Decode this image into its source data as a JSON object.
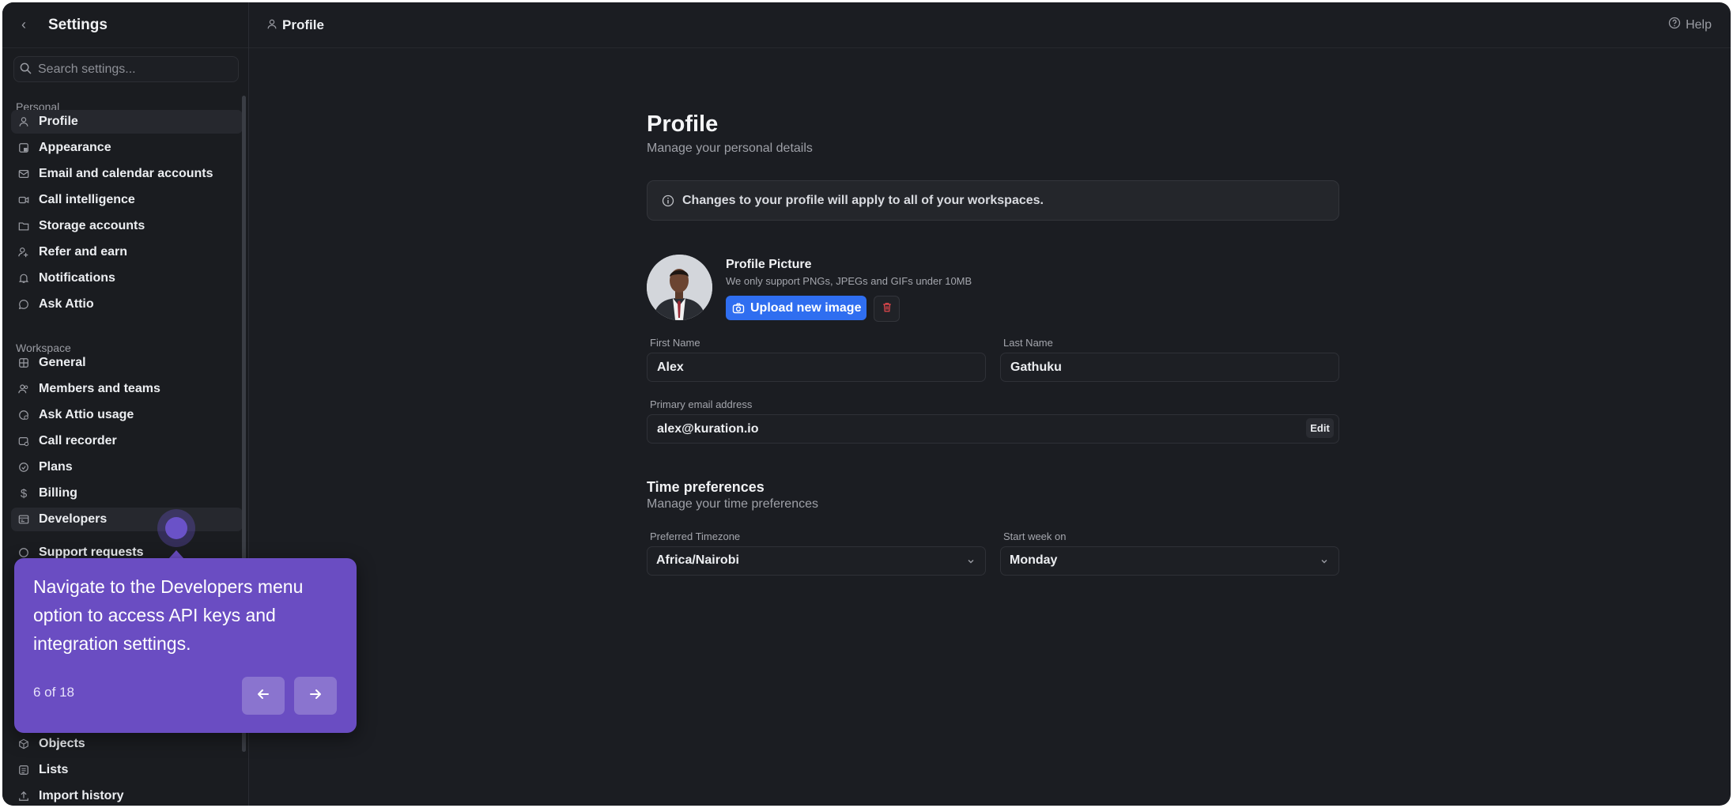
{
  "sidebar": {
    "title": "Settings",
    "search_placeholder": "Search settings...",
    "personal_label": "Personal",
    "workspace_label": "Workspace",
    "items": [
      {
        "label": "Profile",
        "icon": "user-icon"
      },
      {
        "label": "Appearance",
        "icon": "appearance-icon"
      },
      {
        "label": "Email and calendar accounts",
        "icon": "mail-calendar-icon"
      },
      {
        "label": "Call intelligence",
        "icon": "video-icon"
      },
      {
        "label": "Storage accounts",
        "icon": "folder-icon"
      },
      {
        "label": "Refer and earn",
        "icon": "refer-icon"
      },
      {
        "label": "Notifications",
        "icon": "bell-icon"
      },
      {
        "label": "Ask Attio",
        "icon": "chat-icon"
      },
      {
        "label": "General",
        "icon": "grid-icon"
      },
      {
        "label": "Members and teams",
        "icon": "users-icon"
      },
      {
        "label": "Ask Attio usage",
        "icon": "usage-icon"
      },
      {
        "label": "Call recorder",
        "icon": "recorder-icon"
      },
      {
        "label": "Plans",
        "icon": "plans-icon"
      },
      {
        "label": "Billing",
        "icon": "dollar-icon"
      },
      {
        "label": "Developers",
        "icon": "developers-icon"
      },
      {
        "label": "Support requests",
        "icon": "support-icon"
      },
      {
        "label": "Objects",
        "icon": "cube-icon"
      },
      {
        "label": "Lists",
        "icon": "list-icon"
      },
      {
        "label": "Import history",
        "icon": "upload-icon"
      }
    ]
  },
  "topbar": {
    "title": "Profile",
    "help_label": "Help"
  },
  "main": {
    "title": "Profile",
    "subtitle": "Manage your personal details",
    "notice": "Changes to your profile will apply to all of your workspaces.",
    "picture_title": "Profile Picture",
    "picture_hint": "We only support PNGs, JPEGs and GIFs under 10MB",
    "upload_label": "Upload new image",
    "first_name_label": "First Name",
    "first_name": "Alex",
    "last_name_label": "Last Name",
    "last_name": "Gathuku",
    "email_label": "Primary email address",
    "email": "alex@kuration.io",
    "edit_label": "Edit",
    "time_title": "Time preferences",
    "time_subtitle": "Manage your time preferences",
    "timezone_label": "Preferred Timezone",
    "timezone": "Africa/Nairobi",
    "week_label": "Start week on",
    "week_start": "Monday"
  },
  "tour": {
    "text": "Navigate to the Developers menu option to access API keys and integration settings.",
    "counter": "6 of 18"
  },
  "colors": {
    "background": "#1b1d22",
    "accent": "#2f6ef0",
    "tour": "#6a4dc2",
    "danger": "#e5484d"
  }
}
